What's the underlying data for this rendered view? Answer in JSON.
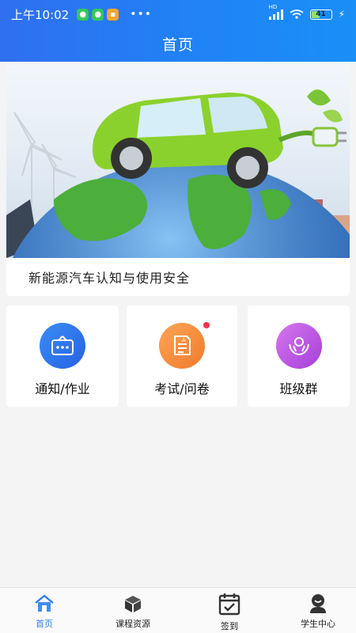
{
  "status_bar": {
    "time": "上午10:02",
    "battery": "41",
    "network_tag": "HD"
  },
  "header": {
    "title": "首页"
  },
  "banner": {
    "caption": "新能源汽车认知与使用安全"
  },
  "quick_entries": [
    {
      "label": "通知/作业",
      "icon": "notice-board-icon",
      "color": "#2f6ff0"
    },
    {
      "label": "考试/问卷",
      "icon": "exam-paper-icon",
      "color": "#f48a3a",
      "has_new_dot": true
    },
    {
      "label": "班级群",
      "icon": "group-hands-icon",
      "color": "#c15fe6"
    }
  ],
  "bottom_nav": [
    {
      "label": "首页",
      "icon": "home-icon",
      "active": true
    },
    {
      "label": "课程资源",
      "icon": "cube-icon",
      "active": false
    },
    {
      "label": "签到",
      "icon": "calendar-check-icon",
      "active": false
    },
    {
      "label": "学生中心",
      "icon": "user-icon",
      "active": false
    }
  ],
  "colors": {
    "brand_blue": "#2f6ff0",
    "active_nav": "#2f7ff2",
    "badge_red": "#f0334f"
  }
}
